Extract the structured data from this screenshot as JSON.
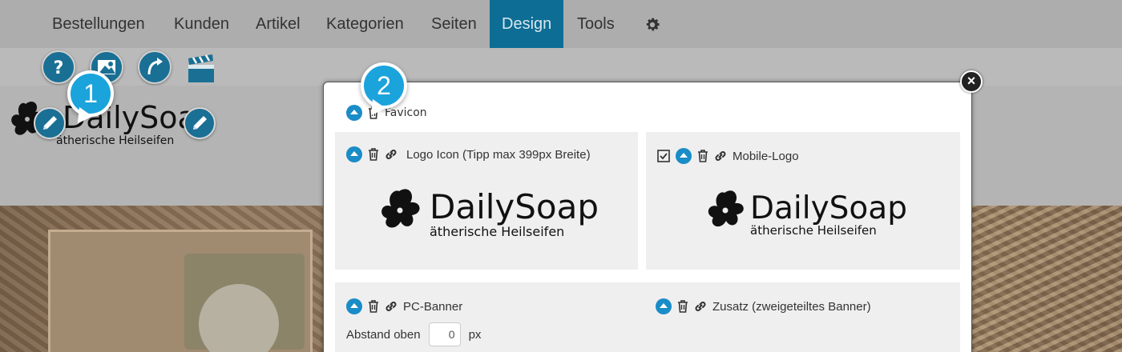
{
  "nav": {
    "items": [
      {
        "label": "Bestellungen"
      },
      {
        "label": "Kunden"
      },
      {
        "label": "Artikel"
      },
      {
        "label": "Kategorien"
      },
      {
        "label": "Seiten"
      },
      {
        "label": "Design",
        "active": true
      },
      {
        "label": "Tools"
      }
    ],
    "settings_icon": "gear-icon"
  },
  "toolbar": {
    "icons": [
      "help-icon",
      "image-settings-icon",
      "redirect-icon",
      "video-clapper-icon"
    ]
  },
  "background_logo": {
    "title": "DailySoap",
    "subtitle": "ätherische Heilseifen"
  },
  "callouts": [
    "1",
    "2"
  ],
  "modal": {
    "close_label": "×",
    "favicon_label": "Favicon",
    "logo_icon_label": "Logo Icon (Tipp max 399px Breite)",
    "mobile_logo_label": "Mobile-Logo",
    "logo_title": "DailySoap",
    "logo_subtitle": "ätherische Heilseifen",
    "pc_banner_label": "PC-Banner",
    "zusatz_label": "Zusatz (zweigeteiltes Banner)",
    "abstand_label": "Abstand oben",
    "abstand_value": "0",
    "abstand_unit": "px"
  },
  "colors": {
    "nav_active": "#0d6d94",
    "accent": "#1a8cc7",
    "bubble": "#1ba3dc"
  }
}
